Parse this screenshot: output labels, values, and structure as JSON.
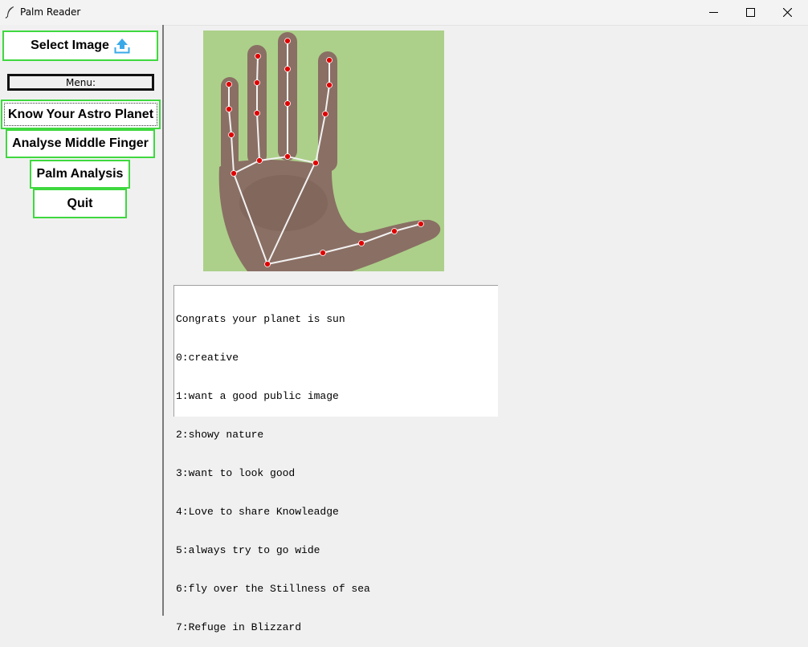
{
  "window": {
    "title": "Palm Reader",
    "app_icon": "feather-icon",
    "controls": [
      "minimize-icon",
      "maximize-icon",
      "close-icon"
    ]
  },
  "sidebar": {
    "select_image_label": "Select Image",
    "select_image_icon": "upload-icon",
    "menu_label": "Menu:",
    "buttons": {
      "astro": "Know Your Astro Planet",
      "middle": "Analyse Middle Finger",
      "palm": "Palm Analysis",
      "quit": "Quit"
    },
    "button_border_color": "#3fd83f"
  },
  "image": {
    "subject": "hand-landmarks-image",
    "background_color": "#acd08a",
    "landmark_color": "#e00000"
  },
  "output": {
    "lines": [
      "Congrats your planet is sun",
      "0:creative",
      "1:want a good public image",
      "2:showy nature",
      "3:want to look good",
      "4:Love to share Knowleadge",
      "5:always try to go wide",
      "6:fly over the Stillness of sea",
      "7:Refuge in Blizzard"
    ]
  }
}
